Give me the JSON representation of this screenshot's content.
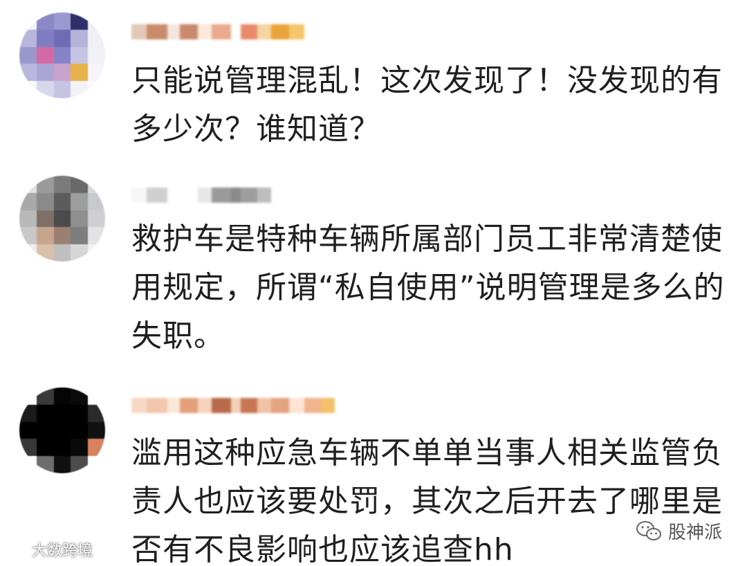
{
  "comments": [
    {
      "text": "只能说管理混乱！这次发现了！没发现的有\n多少次？谁知道？",
      "avatar_colors": [
        "#f4f3f8",
        "#8c88c6",
        "#9b9ad0",
        "#2f2f6a",
        "#eeeef4",
        "#b9b6dc",
        "#7f7dc1",
        "#6f6cb5",
        "#b5b4d8",
        "#f0eff5",
        "#9a97cc",
        "#d26aa6",
        "#8682c7",
        "#c6c4e4",
        "#f2f1f6",
        "#b8b7dd",
        "#a9a6d5",
        "#c9a3cb",
        "#e7b24a",
        "#f6f5f9",
        "#f7f7fa",
        "#d8d7ea",
        "#c4c3e2",
        "#f3f2f7",
        "#fafafc"
      ],
      "username_colors": [
        "#e2c8b5",
        "#c98a6a",
        "#f3e6dc",
        "#c8896c",
        "#fbe9da",
        "#e9a98b",
        "#ffffff",
        "#e98a6a",
        "#f6d4a0",
        "#e8a33a",
        "#f3c66b"
      ]
    },
    {
      "text": "救护车是特种车辆所属部门员工非常清楚使\n用规定，所谓“私自使用”说明管理是多么的\n失职。",
      "avatar_colors": [
        "#dfe0e2",
        "#9b9b9b",
        "#7b7b7b",
        "#6a6a6a",
        "#d8d8dc",
        "#a9a9aa",
        "#8a8a8a",
        "#5c5c5c",
        "#9d9d9d",
        "#c8c9cc",
        "#b8b8b8",
        "#7f6f67",
        "#4b4b4b",
        "#8f8f8f",
        "#cfcfd2",
        "#c8c8c8",
        "#c6a58e",
        "#9a8070",
        "#7d7d7d",
        "#e3e3e5",
        "#eeeeef",
        "#d9c0ac",
        "#bfbfbf",
        "#d6d6d6",
        "#f2f2f3"
      ],
      "username_colors": [
        "#f6f6f6",
        "#cfcfcf",
        "#ffffff",
        "#ffffff",
        "#e7e7e7",
        "#9a9a9a",
        "#8a8a8a",
        "#9d9d9d",
        "#bdbdbd"
      ]
    },
    {
      "text": "滥用这种应急车辆不单单当事人相关监管负\n责人也应该要处罚，其次之后开去了哪里是\n否有不良影响也应该追查hh",
      "avatar_colors": [
        "#ffffff",
        "#3a3a3a",
        "#050505",
        "#0b0b0b",
        "#ffffff",
        "#1a1a1a",
        "#000000",
        "#000000",
        "#000000",
        "#2b2b2b",
        "#000000",
        "#000000",
        "#000000",
        "#000000",
        "#111111",
        "#383838",
        "#000000",
        "#000000",
        "#0a0a0a",
        "#d8805f",
        "#ffffff",
        "#6d6d6d",
        "#101010",
        "#4d4d4d",
        "#ffffff"
      ],
      "username_colors": [
        "#f6d8c5",
        "#f2c7ae",
        "#fbe7d9",
        "#e3a07a",
        "#f7d2bd",
        "#b96a4a",
        "#f4d0b8",
        "#c77853",
        "#f1c2a7",
        "#e5a380",
        "#fbe4d6",
        "#f0b58d",
        "#f4c06a"
      ]
    }
  ],
  "watermark_left": {
    "icon": "weibo-icon",
    "text": "大数跨境"
  },
  "watermark_right": {
    "icon": "wechat-icon",
    "text": "股神派"
  }
}
